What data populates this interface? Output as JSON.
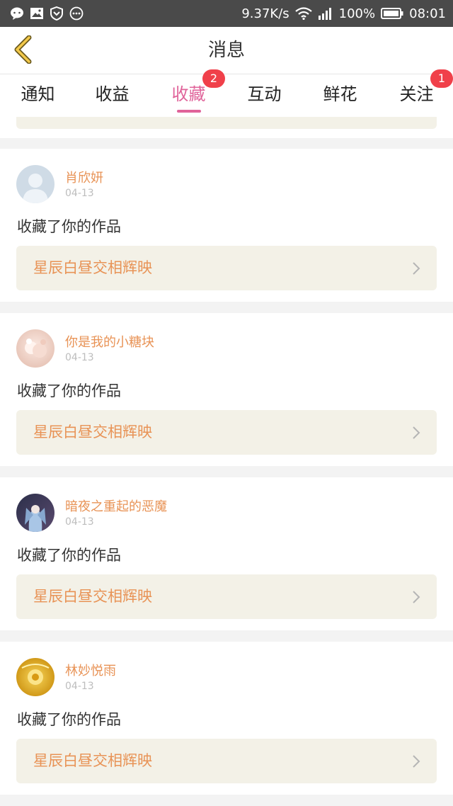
{
  "status_bar": {
    "left_icons": [
      "chat-bubble-icon",
      "image-icon",
      "shield-icon",
      "more-dots-icon"
    ],
    "network_speed": "9.37K/s",
    "battery_percent": "100%",
    "time": "08:01"
  },
  "header": {
    "title": "消息",
    "back_icon": "chevron-left-icon"
  },
  "tabs": [
    {
      "label": "通知",
      "badge": ""
    },
    {
      "label": "收益",
      "badge": ""
    },
    {
      "label": "收藏",
      "badge": "2",
      "active": true
    },
    {
      "label": "互动",
      "badge": ""
    },
    {
      "label": "鲜花",
      "badge": ""
    },
    {
      "label": "关注",
      "badge": "1"
    }
  ],
  "notifications": [
    {
      "name": "肖欣妍",
      "date": "04-13",
      "action": "收藏了你的作品",
      "work_title": "星辰白昼交相辉映",
      "avatar": "default-avatar-icon"
    },
    {
      "name": "你是我的小糖块",
      "date": "04-13",
      "action": "收藏了你的作品",
      "work_title": "星辰白昼交相辉映",
      "avatar": "photo-avatar"
    },
    {
      "name": "暗夜之重起的恶魔",
      "date": "04-13",
      "action": "收藏了你的作品",
      "work_title": "星辰白昼交相辉映",
      "avatar": "photo-avatar"
    },
    {
      "name": "林妙悦雨",
      "date": "04-13",
      "action": "收藏了你的作品",
      "work_title": "星辰白昼交相辉映",
      "avatar": "photo-avatar"
    }
  ],
  "colors": {
    "accent_pink": "#e0639a",
    "name_orange": "#e89356",
    "badge_red": "#f0404a",
    "card_bg": "#f3f1e7"
  }
}
